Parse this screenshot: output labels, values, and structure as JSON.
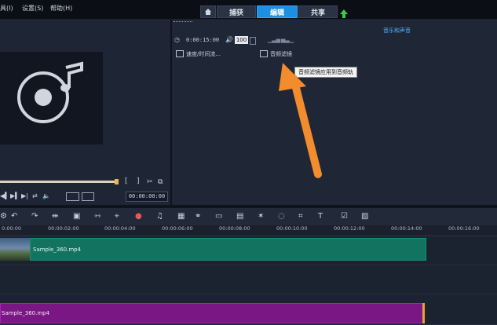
{
  "menu": {
    "tools_partial": "具(I)",
    "settings": "设置(S)",
    "help": "帮助(H)"
  },
  "tabs": {
    "capture": "捕获",
    "edit": "编辑",
    "share": "共享"
  },
  "right_panel": {
    "category": "音乐和声音",
    "timecode": "0:00:15:00",
    "volume": "100",
    "speed_label": "速度/时间流...",
    "audio_filter_label": "音频滤镜",
    "tooltip": "音频滤镜应用到音频轨"
  },
  "preview": {
    "bracket_in": "[",
    "bracket_out": "]",
    "timecode": "00:00:00:00"
  },
  "ruler": [
    "0:00:00",
    "00:00:02:00",
    "00:00:04:00",
    "00:00:06:00",
    "00:00:08:00",
    "00:00:10:00",
    "00:00:12:00",
    "00:00:14:00",
    "00:00:16:00"
  ],
  "timeline": {
    "video_clip": "Sample_360.mp4",
    "audio_clip": "Sample_360.mp4"
  },
  "colors": {
    "accent": "#1d8fe0",
    "video_clip": "#127460",
    "audio_clip": "#7a1784",
    "arrow": "#f28c2e"
  }
}
